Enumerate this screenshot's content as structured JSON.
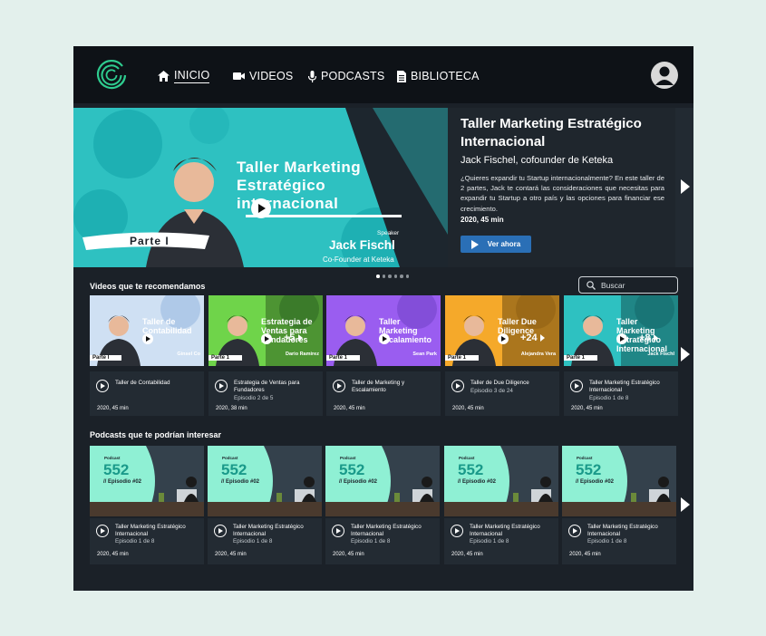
{
  "nav": {
    "items": [
      {
        "label": "INICIO",
        "icon": "home-icon",
        "active": true
      },
      {
        "label": "VIDEOS",
        "icon": "video-camera-icon",
        "active": false
      },
      {
        "label": "PODCASTS",
        "icon": "microphone-icon",
        "active": false
      },
      {
        "label": "BIBLIOTECA",
        "icon": "document-icon",
        "active": false
      }
    ],
    "avatar_icon": "user-avatar-icon"
  },
  "hero": {
    "image_title_lines": [
      "Taller Marketing",
      "Estratégico",
      "internacional"
    ],
    "image_tag": "Parte I",
    "speaker_caption": "Speaker",
    "speaker_name": "Jack Fischl",
    "speaker_role": "Co-Founder at Keteka",
    "title": "Taller Marketing Estratégico Internacional",
    "subtitle": "Jack Fischel, cofounder de Keteka",
    "description": "¿Quieres expandir tu Startup internacionalmente? En este taller de 2 partes, Jack te contará las consideraciones que necesitas para expandir tu Startup a otro país y las opciones para financiar ese crecimiento.",
    "meta": "2020, 45 min",
    "cta_label": "Ver ahora",
    "carousel_count": 6,
    "carousel_active": 0
  },
  "videos": {
    "section_title": "Videos que te recomendamos",
    "search_placeholder": "Buscar",
    "cards": [
      {
        "thumb_title": "Taller de Contabilidad",
        "thumb_tag": "Parte I",
        "thumb_speaker": "Ginsel Co",
        "extra": "",
        "title": "Taller de Contabilidad",
        "subtitle": "",
        "meta": "2020, 45 min",
        "color": "#cfe0f3",
        "accent": "#8fb1dd"
      },
      {
        "thumb_title": "Estrategia de Ventas para Fundadores",
        "thumb_tag": "Parte 1",
        "thumb_speaker": "Dario Ramirez",
        "extra": "+5",
        "title": "Estrategia de Ventas para Fundadores",
        "subtitle": "Episodio 2 de 5",
        "meta": "2020, 38 min",
        "color": "#6fd44a",
        "accent": "#3c8c2f"
      },
      {
        "thumb_title": "Taller Marketing Escalamiento",
        "thumb_tag": "Parte 1",
        "thumb_speaker": "Sean Park",
        "extra": "",
        "title": "Taller de Marketing y Escalamiento",
        "subtitle": "",
        "meta": "2020, 45 min",
        "color": "#9a5df0",
        "accent": "#6b3fc2"
      },
      {
        "thumb_title": "Taller Due Diligence",
        "thumb_tag": "Parte 1",
        "thumb_speaker": "Alejandra Vera",
        "extra": "+24",
        "title": "Taller de Due Diligence",
        "subtitle": "Episodio 3 de 24",
        "meta": "2020, 45 min",
        "color": "#f5a92a",
        "accent": "#c7861a"
      },
      {
        "thumb_title": "Taller Marketing Estratégico Internacional",
        "thumb_tag": "Parte 1",
        "thumb_speaker": "Jack Fischl",
        "extra": "+8",
        "title": "Taller Marketing Estratégico Internacional",
        "subtitle": "Episodio 1 de 8",
        "meta": "2020, 45 min",
        "color": "#2ec1c1",
        "accent": "#1b8f94"
      }
    ]
  },
  "podcasts": {
    "section_title": "Podcasts que te podrían interesar",
    "cards": [
      {
        "label": "Podcast",
        "number": "552",
        "episode": "// Episodio #02",
        "title": "Taller Marketing Estratégico Internacional",
        "subtitle": "Episodio 1 de 8",
        "meta": "2020, 45 min"
      },
      {
        "label": "Podcast",
        "number": "552",
        "episode": "// Episodio #02",
        "title": "Taller Marketing Estratégico Internacional",
        "subtitle": "Episodio 1 de 8",
        "meta": "2020, 45 min"
      },
      {
        "label": "Podcast",
        "number": "552",
        "episode": "// Episodio #02",
        "title": "Taller Marketing Estratégico Internacional",
        "subtitle": "Episodio 1 de 8",
        "meta": "2020, 45 min"
      },
      {
        "label": "Podcast",
        "number": "552",
        "episode": "// Episodio #02",
        "title": "Taller Marketing Estratégico Internacional",
        "subtitle": "Episodio 1 de 8",
        "meta": "2020, 45 min"
      },
      {
        "label": "Podcast",
        "number": "552",
        "episode": "// Episodio #02",
        "title": "Taller Marketing Estratégico Internacional",
        "subtitle": "Episodio 1 de 8",
        "meta": "2020, 45 min"
      }
    ]
  },
  "colors": {
    "background": "#e3f0ec",
    "app": "#1b2128",
    "nav": "#0e1217",
    "brand": "#2ecc8f",
    "cta": "#2a6fb6",
    "podcast_mint": "#8ff0d4"
  }
}
